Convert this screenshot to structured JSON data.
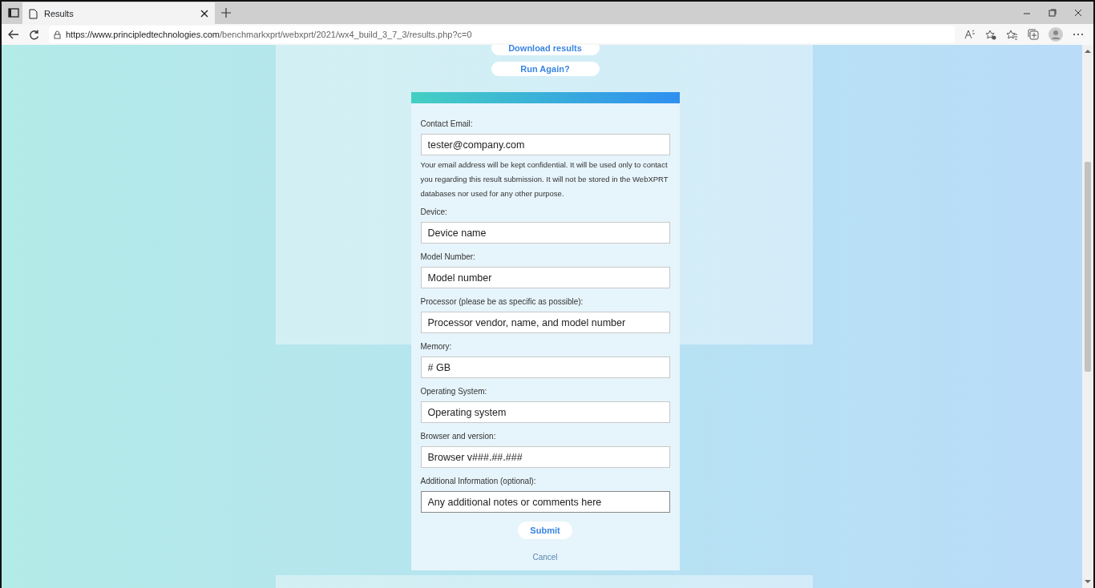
{
  "browser": {
    "tab_title": "Results",
    "url_host": "https://www.principledtechnologies.com",
    "url_path": "/benchmarkxprt/webxprt/2021/wx4_build_3_7_3/results.php?c=0"
  },
  "top_buttons": [
    "Download results",
    "Run Again?"
  ],
  "form": {
    "fields": [
      {
        "kind": "input",
        "label": "Contact Email:",
        "value": "tester@company.com",
        "focused": false
      },
      {
        "kind": "note",
        "text": "Your email address will be kept confidential. It will be used only to contact you regarding this result submission. It will not be stored in the WebXPRT databases nor used for any other purpose."
      },
      {
        "kind": "input",
        "label": "Device:",
        "value": "Device name",
        "focused": false
      },
      {
        "kind": "input",
        "label": "Model Number:",
        "value": "Model number",
        "focused": false
      },
      {
        "kind": "input",
        "label": "Processor (please be as specific as possible):",
        "value": "Processor vendor, name, and model number",
        "focused": false
      },
      {
        "kind": "input",
        "label": "Memory:",
        "value": "# GB",
        "focused": false
      },
      {
        "kind": "input",
        "label": "Operating System:",
        "value": "Operating system",
        "focused": false
      },
      {
        "kind": "input",
        "label": "Browser and version:",
        "value": "Browser v###.##.###",
        "focused": false
      },
      {
        "kind": "input",
        "label": "Additional Information (optional):",
        "value": "Any additional notes or comments here",
        "focused": true
      }
    ],
    "submit": "Submit",
    "cancel": "Cancel"
  }
}
